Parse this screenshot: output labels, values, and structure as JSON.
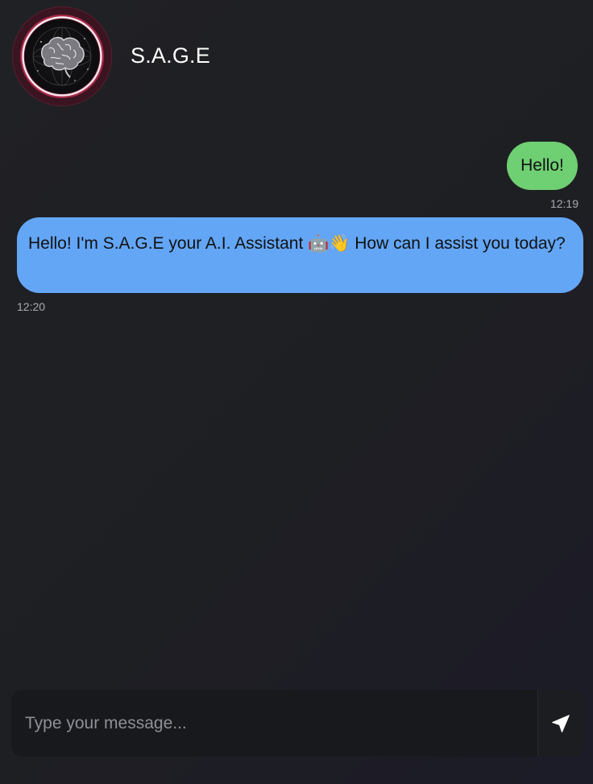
{
  "header": {
    "title": "S.A.G.E",
    "avatar_icon": "brain-icon"
  },
  "messages": [
    {
      "sender": "user",
      "text": "Hello!",
      "time": "12:19",
      "bubble_color": "#6fcf73"
    },
    {
      "sender": "assistant",
      "text": "Hello! I'm S.A.G.E your A.I. Assistant 🤖👋 How can I assist you today?",
      "time": "12:20",
      "bubble_color": "#64a6f6"
    }
  ],
  "composer": {
    "placeholder": "Type your message...",
    "value": "",
    "send_icon": "send-icon"
  },
  "colors": {
    "background": "#1f2024",
    "ring_accent": "#e0204f",
    "text_primary": "#ffffff",
    "timestamp": "#a8aab0"
  }
}
